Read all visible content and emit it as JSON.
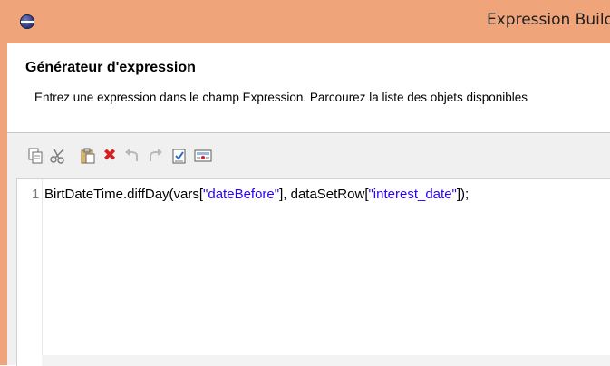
{
  "window": {
    "title": "Expression Builder",
    "app_icon": "eclipse-icon"
  },
  "header": {
    "title": "Générateur d'expression",
    "description": "Entrez une expression dans le champ Expression. Parcourez la liste des objets disponibles"
  },
  "toolbar": {
    "items": [
      {
        "name": "copy-icon"
      },
      {
        "name": "cut-icon"
      },
      {
        "name": "paste-icon"
      },
      {
        "name": "delete-icon"
      },
      {
        "name": "undo-icon"
      },
      {
        "name": "redo-icon"
      },
      {
        "name": "validate-icon"
      },
      {
        "name": "calculate-icon"
      }
    ]
  },
  "editor": {
    "line_number": "1",
    "code": {
      "part1": "BirtDateTime.diffDay(vars[",
      "str1": "\"dateBefore\"",
      "part2": "], dataSetRow[",
      "str2": "\"interest_date\"",
      "part3": "]);"
    }
  },
  "colors": {
    "titlebar": "#f0a47a",
    "string_literal": "#2a00ff",
    "delete_red": "#d42020"
  }
}
